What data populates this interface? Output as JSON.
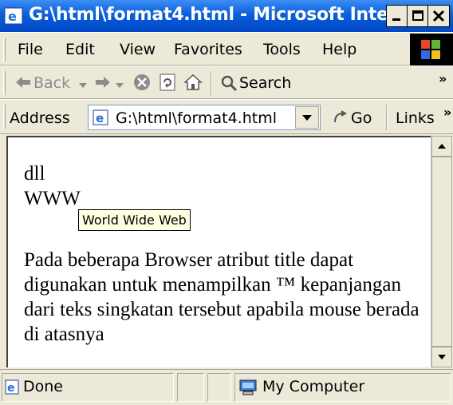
{
  "window": {
    "title": "G:\\html\\format4.html - Microsoft Inter..."
  },
  "menu": {
    "items": [
      "File",
      "Edit",
      "View",
      "Favorites",
      "Tools",
      "Help"
    ]
  },
  "toolbar": {
    "back_label": "Back",
    "search_label": "Search",
    "overflow": "»"
  },
  "address": {
    "label": "Address",
    "value": "G:\\html\\format4.html",
    "go_label": "Go",
    "links_label": "Links",
    "overflow": "»"
  },
  "document": {
    "line1": "dll",
    "abbr_text": "WWW",
    "tooltip": "World Wide Web",
    "paragraph": "Pada beberapa Browser atribut title dapat digunakan untuk menampilkan ™ kepanjangan dari teks singkatan tersebut apabila mouse berada di atasnya"
  },
  "status": {
    "left_text": "Done",
    "zone_text": "My Computer"
  },
  "colors": {
    "titlebar": "#0a5fd8",
    "chrome": "#ece9d8",
    "tooltip_bg": "#ffffe1"
  }
}
